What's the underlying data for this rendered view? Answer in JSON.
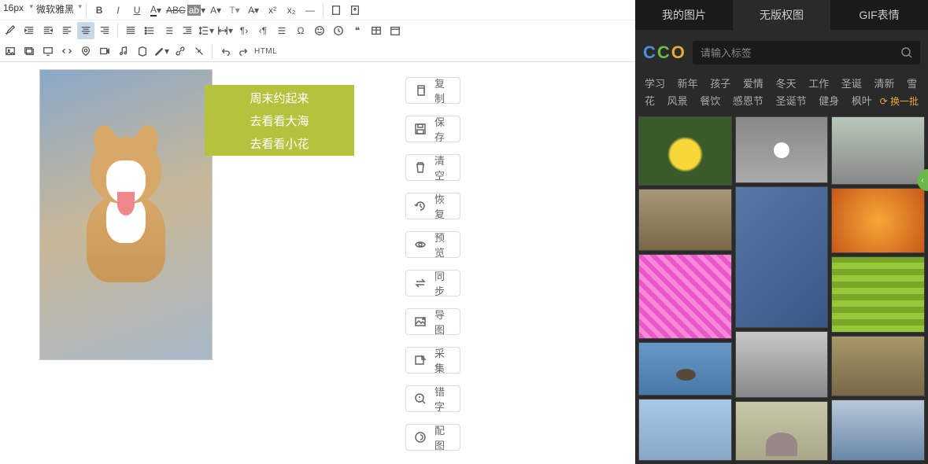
{
  "toolbar": {
    "font_size": "16px",
    "font_family": "微软雅黑"
  },
  "overlay": {
    "line1": "周末约起来",
    "line2": "去看看大海",
    "line3": "去看看小花"
  },
  "actions": [
    {
      "icon": "copy",
      "label": "复制"
    },
    {
      "icon": "save",
      "label": "保存"
    },
    {
      "icon": "trash",
      "label": "清空"
    },
    {
      "icon": "undo2",
      "label": "恢复"
    },
    {
      "icon": "eye",
      "label": "预览"
    },
    {
      "icon": "sync",
      "label": "同步"
    },
    {
      "icon": "image-export",
      "label": "导图"
    },
    {
      "icon": "collect",
      "label": "采集"
    },
    {
      "icon": "search-plus",
      "label": "错字"
    },
    {
      "icon": "gear",
      "label": "配图"
    }
  ],
  "right_panel": {
    "tabs": [
      "我的图片",
      "无版权图",
      "GIF表情"
    ],
    "active_tab_index": 1,
    "search_placeholder": "请输入标签",
    "tags": [
      "学习",
      "新年",
      "孩子",
      "爱情",
      "冬天",
      "工作",
      "圣诞",
      "清新",
      "雪花",
      "风景",
      "餐饮",
      "感恩节",
      "圣诞节",
      "健身",
      "枫叶"
    ],
    "refresh_label": "换一批",
    "logo": "CCO",
    "side_badge": "‹"
  }
}
